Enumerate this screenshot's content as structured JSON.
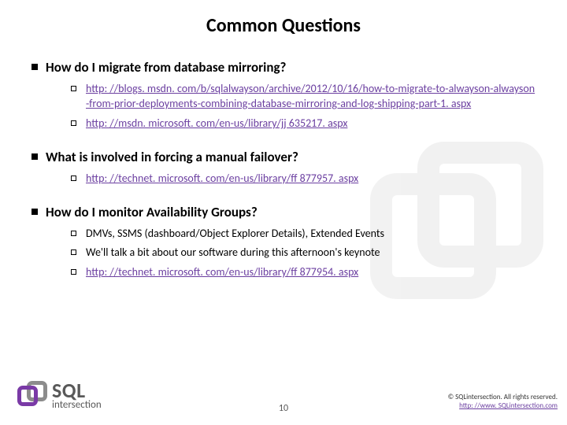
{
  "title": "Common Questions",
  "sections": [
    {
      "question": "How do I migrate from database mirroring?",
      "items": [
        {
          "type": "link",
          "text": "http: //blogs. msdn. com/b/sqlalwayson/archive/2012/10/16/how-to-migrate-to-alwayson-alwayson-from-prior-deployments-combining-database-mirroring-and-log-shipping-part-1. aspx"
        },
        {
          "type": "link",
          "text": "http: //msdn. microsoft. com/en-us/library/jj 635217. aspx"
        }
      ]
    },
    {
      "question": "What is involved in forcing a manual failover?",
      "items": [
        {
          "type": "link",
          "text": "http: //technet. microsoft. com/en-us/library/ff 877957. aspx"
        }
      ]
    },
    {
      "question": "How do I monitor Availability Groups?",
      "items": [
        {
          "type": "text",
          "text": "DMVs, SSMS (dashboard/Object Explorer Details), Extended Events"
        },
        {
          "type": "text",
          "text": "We'll talk a bit about our software during this afternoon's keynote"
        },
        {
          "type": "link",
          "text": "http: //technet. microsoft. com/en-us/library/ff 877954. aspx"
        }
      ]
    }
  ],
  "footer": {
    "logo_main": "SQL",
    "logo_sub": "intersection",
    "page": "10",
    "copyright": "© SQLintersection. All rights reserved.",
    "url": "http: //www. SQLintersection.com"
  }
}
